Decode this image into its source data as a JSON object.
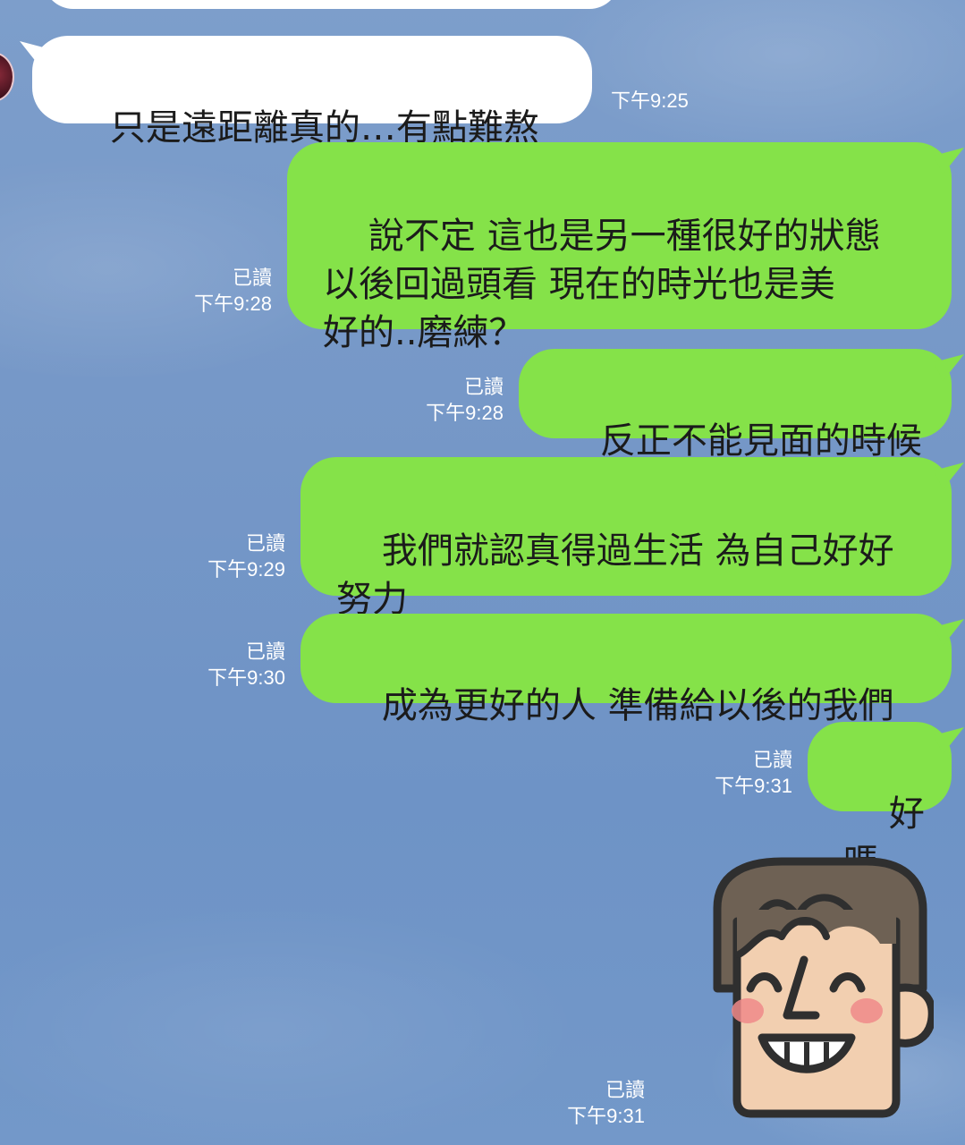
{
  "messages": [
    {
      "id": "m1",
      "direction": "incoming",
      "text": "只是遠距離真的…有點難熬",
      "time": "下午9:25"
    },
    {
      "id": "m2",
      "direction": "outgoing",
      "text": "說不定 這也是另一種很好的狀態\n以後回過頭看 現在的時光也是美\n好的..磨練？",
      "read": "已讀",
      "time": "下午9:28"
    },
    {
      "id": "m3",
      "direction": "outgoing",
      "text": "反正不能見面的時候",
      "read": "已讀",
      "time": "下午9:28"
    },
    {
      "id": "m4",
      "direction": "outgoing",
      "text": "我們就認真得過生活 為自己好好\n努力",
      "read": "已讀",
      "time": "下午9:29"
    },
    {
      "id": "m5",
      "direction": "outgoing",
      "text": "成為更好的人 準備給以後的我們",
      "read": "已讀",
      "time": "下午9:30"
    },
    {
      "id": "m6",
      "direction": "outgoing",
      "text": "好嗎",
      "read": "已讀",
      "time": "下午9:31"
    },
    {
      "id": "m7",
      "direction": "outgoing",
      "type": "sticker",
      "sticker": "smiling-man-face-sticker",
      "read": "已讀",
      "time": "下午9:31"
    }
  ],
  "colors": {
    "outgoing_bubble": "#85e249",
    "incoming_bubble": "#ffffff",
    "background": "#7597c7",
    "meta_text": "#ffffff"
  }
}
